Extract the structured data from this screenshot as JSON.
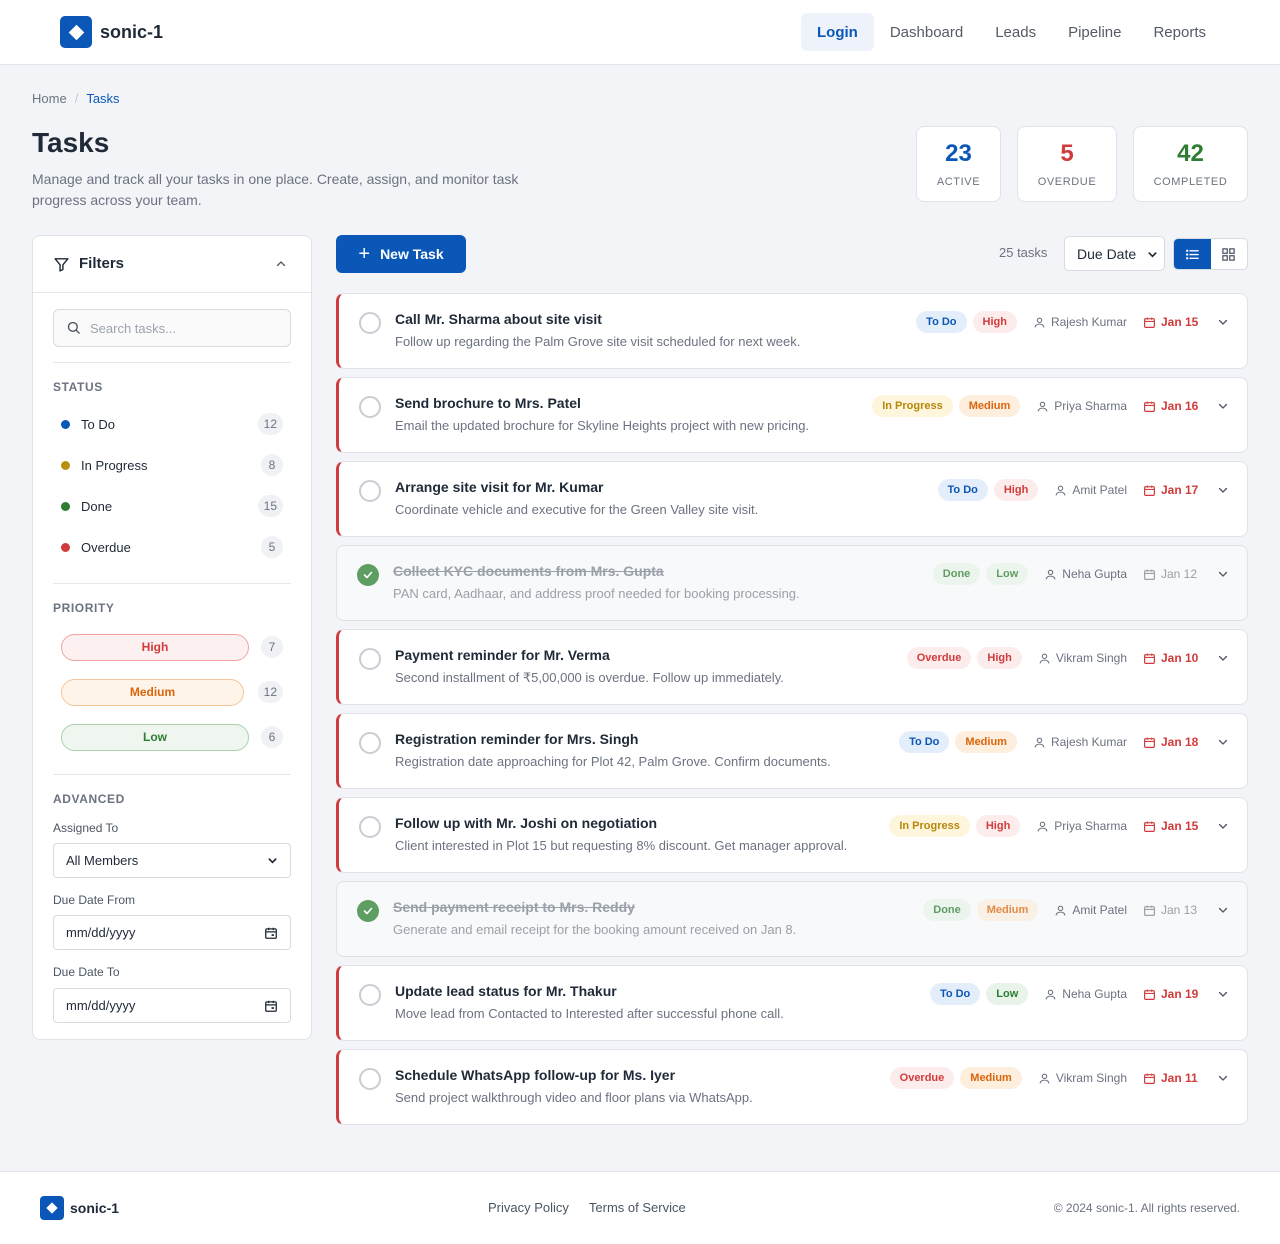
{
  "app": {
    "name": "sonic-1"
  },
  "nav": {
    "items": [
      {
        "label": "Login",
        "active": true
      },
      {
        "label": "Dashboard",
        "active": false
      },
      {
        "label": "Leads",
        "active": false
      },
      {
        "label": "Pipeline",
        "active": false
      },
      {
        "label": "Reports",
        "active": false
      }
    ]
  },
  "breadcrumb": {
    "home": "Home",
    "separator": "/",
    "current": "Tasks"
  },
  "page": {
    "title": "Tasks",
    "description": "Manage and track all your tasks in one place. Create, assign, and monitor task progress across your team."
  },
  "stats": [
    {
      "value": "23",
      "label": "ACTIVE",
      "color": "#0b57b7"
    },
    {
      "value": "5",
      "label": "OVERDUE",
      "color": "#d13b3b"
    },
    {
      "value": "42",
      "label": "COMPLETED",
      "color": "#2e7d32"
    }
  ],
  "filters": {
    "title": "Filters",
    "search_placeholder": "Search tasks...",
    "status_label": "STATUS",
    "statuses": [
      {
        "label": "To Do",
        "count": "12",
        "color": "#0b57b7"
      },
      {
        "label": "In Progress",
        "count": "8",
        "color": "#b8900f"
      },
      {
        "label": "Done",
        "count": "15",
        "color": "#2e7d32"
      },
      {
        "label": "Overdue",
        "count": "5",
        "color": "#d13b3b"
      }
    ],
    "priority_label": "PRIORITY",
    "priorities": [
      {
        "label": "High",
        "count": "7",
        "color": "#d13b3b",
        "bg": "#fdf0f0",
        "border": "#f0a5a5"
      },
      {
        "label": "Medium",
        "count": "12",
        "color": "#d9650b",
        "bg": "#fef4ea",
        "border": "#f4c59a"
      },
      {
        "label": "Low",
        "count": "6",
        "color": "#2e7d32",
        "bg": "#eef6ef",
        "border": "#a9d1ab"
      }
    ],
    "advanced_label": "ADVANCED",
    "assigned_label": "Assigned To",
    "assigned_value": "All Members",
    "from_label": "Due Date From",
    "from_value": "mm/dd/yyyy",
    "to_label": "Due Date To",
    "to_value": "mm/dd/yyyy"
  },
  "toolbar": {
    "new_task_label": "New Task",
    "task_count": "25 tasks",
    "sort_value": "Due Date"
  },
  "tasks": [
    {
      "title": "Call Mr. Sharma about site visit",
      "desc": "Follow up regarding the Palm Grove site visit scheduled for next week.",
      "status": "To Do",
      "priority": "High",
      "assignee": "Rajesh Kumar",
      "due": "Jan 15",
      "done": false
    },
    {
      "title": "Send brochure to Mrs. Patel",
      "desc": "Email the updated brochure for Skyline Heights project with new pricing.",
      "status": "In Progress",
      "priority": "Medium",
      "assignee": "Priya Sharma",
      "due": "Jan 16",
      "done": false
    },
    {
      "title": "Arrange site visit for Mr. Kumar",
      "desc": "Coordinate vehicle and executive for the Green Valley site visit.",
      "status": "To Do",
      "priority": "High",
      "assignee": "Amit Patel",
      "due": "Jan 17",
      "done": false
    },
    {
      "title": "Collect KYC documents from Mrs. Gupta",
      "desc": "PAN card, Aadhaar, and address proof needed for booking processing.",
      "status": "Done",
      "priority": "Low",
      "assignee": "Neha Gupta",
      "due": "Jan 12",
      "done": true
    },
    {
      "title": "Payment reminder for Mr. Verma",
      "desc": "Second installment of ₹5,00,000 is overdue. Follow up immediately.",
      "status": "Overdue",
      "priority": "High",
      "assignee": "Vikram Singh",
      "due": "Jan 10",
      "done": false
    },
    {
      "title": "Registration reminder for Mrs. Singh",
      "desc": "Registration date approaching for Plot 42, Palm Grove. Confirm documents.",
      "status": "To Do",
      "priority": "Medium",
      "assignee": "Rajesh Kumar",
      "due": "Jan 18",
      "done": false
    },
    {
      "title": "Follow up with Mr. Joshi on negotiation",
      "desc": "Client interested in Plot 15 but requesting 8% discount. Get manager approval.",
      "status": "In Progress",
      "priority": "High",
      "assignee": "Priya Sharma",
      "due": "Jan 15",
      "done": false
    },
    {
      "title": "Send payment receipt to Mrs. Reddy",
      "desc": "Generate and email receipt for the booking amount received on Jan 8.",
      "status": "Done",
      "priority": "Medium",
      "assignee": "Amit Patel",
      "due": "Jan 13",
      "done": true
    },
    {
      "title": "Update lead status for Mr. Thakur",
      "desc": "Move lead from Contacted to Interested after successful phone call.",
      "status": "To Do",
      "priority": "Low",
      "assignee": "Neha Gupta",
      "due": "Jan 19",
      "done": false
    },
    {
      "title": "Schedule WhatsApp follow-up for Ms. Iyer",
      "desc": "Send project walkthrough video and floor plans via WhatsApp.",
      "status": "Overdue",
      "priority": "Medium",
      "assignee": "Vikram Singh",
      "due": "Jan 11",
      "done": false
    }
  ],
  "badge_styles": {
    "To Do": {
      "color": "#0b57b7",
      "bg": "#e4eefb"
    },
    "In Progress": {
      "color": "#b8860b",
      "bg": "#fdf6dc"
    },
    "Done": {
      "color": "#2e7d32",
      "bg": "#e8f4e9"
    },
    "Overdue": {
      "color": "#d13b3b",
      "bg": "#fdecec"
    },
    "High": {
      "color": "#d13b3b",
      "bg": "#fdecec"
    },
    "Medium": {
      "color": "#d9650b",
      "bg": "#fdeede"
    },
    "Low": {
      "color": "#2e7d32",
      "bg": "#e8f4e9"
    }
  },
  "footer": {
    "name": "sonic-1",
    "privacy": "Privacy Policy",
    "terms": "Terms of Service",
    "copyright": "© 2024 sonic-1. All rights reserved."
  }
}
